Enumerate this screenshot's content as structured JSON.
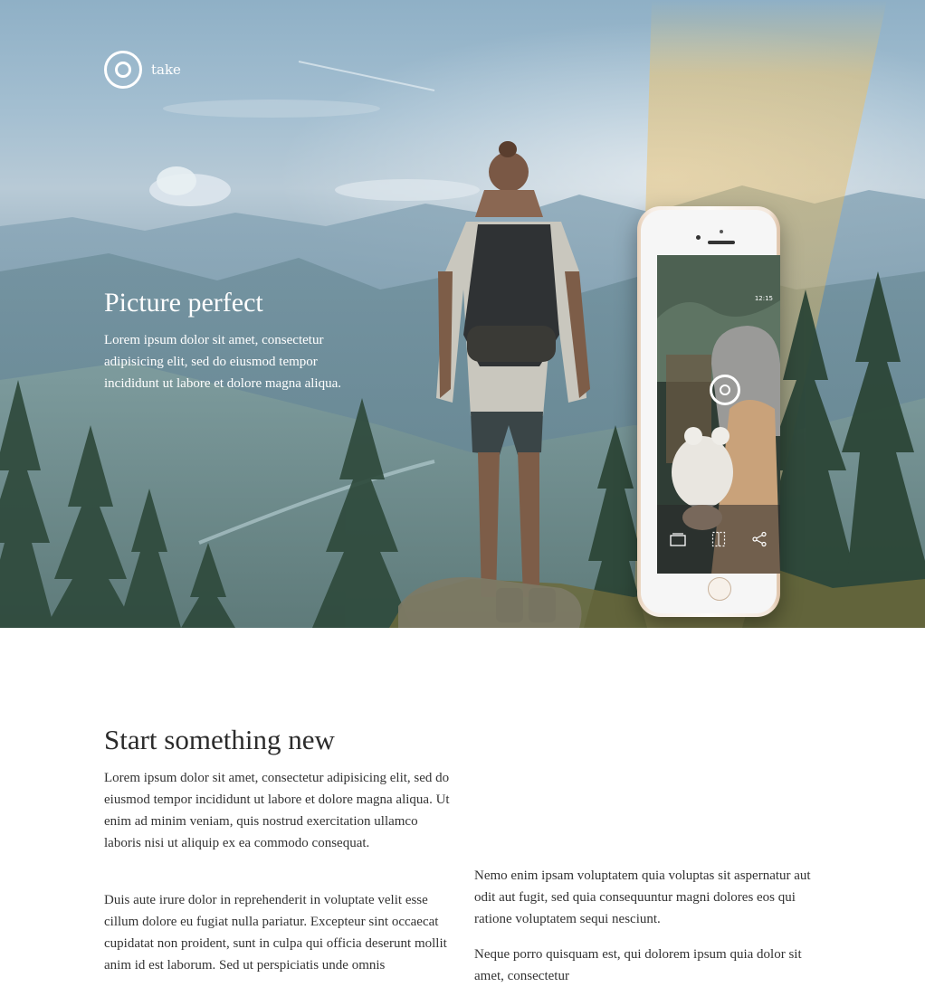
{
  "brand": {
    "name": "take"
  },
  "hero": {
    "title": "Picture perfect",
    "text": "Lorem ipsum dolor sit amet, consectetur adipisicing elit, sed do eiusmod tempor incididunt ut labore et dolore magna aliqua."
  },
  "phone": {
    "status": "12:15"
  },
  "section": {
    "title": "Start something new",
    "paragraphs": [
      "Lorem ipsum dolor sit amet, consectetur adipisicing elit, sed do eiusmod tempor incididunt ut labore et dolore magna aliqua. Ut enim ad minim veniam, quis nostrud exercitation ullamco laboris nisi ut aliquip ex ea commodo consequat.",
      "Duis aute irure dolor in reprehenderit in voluptate velit esse cillum dolore eu fugiat nulla pariatur. Excepteur sint occaecat cupidatat non proident, sunt in culpa qui officia deserunt mollit anim id est laborum. Sed ut perspiciatis unde omnis",
      "Nemo enim ipsam voluptatem quia voluptas sit aspernatur aut odit aut fugit, sed quia consequuntur magni dolores eos qui ratione voluptatem sequi nesciunt.",
      "Neque porro quisquam est, qui dolorem ipsum quia dolor sit amet, consectetur"
    ]
  },
  "icons": {
    "logo": "logo-ring-icon",
    "capture": "capture-ring-icon",
    "gallery": "gallery-icon",
    "crop": "crop-icon",
    "share": "share-icon"
  },
  "colors": {
    "sky": "#a4bfd1",
    "phone_gold": "#e7cfb8",
    "light_beam": "#f2c24a",
    "text_dark": "#2d2d2d"
  }
}
